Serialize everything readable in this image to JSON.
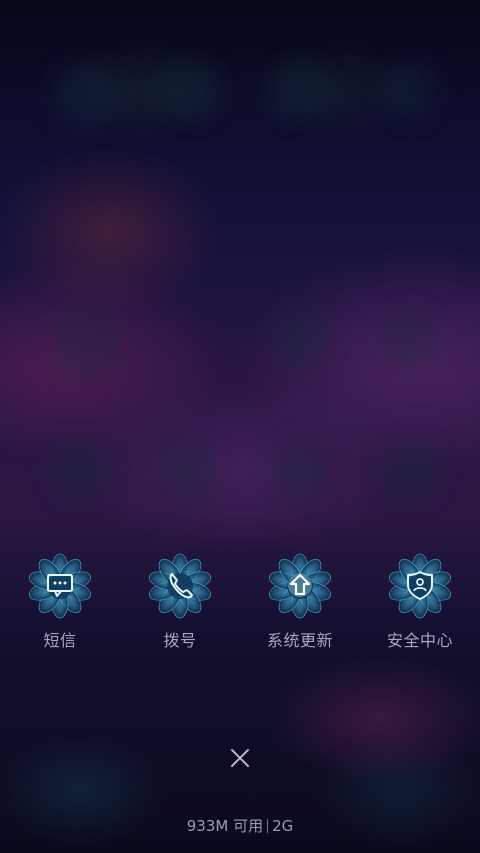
{
  "shortcuts": [
    {
      "label": "短信",
      "icon": "message-icon"
    },
    {
      "label": "拨号",
      "icon": "phone-icon"
    },
    {
      "label": "系统更新",
      "icon": "upload-arrow-icon"
    },
    {
      "label": "安全中心",
      "icon": "shield-icon"
    }
  ],
  "close": {
    "icon": "close-icon"
  },
  "status": {
    "memory": "933M 可用",
    "network": "2G"
  },
  "colors": {
    "icon_glow": "#4fc3e8",
    "label": "#a9a6bc"
  }
}
